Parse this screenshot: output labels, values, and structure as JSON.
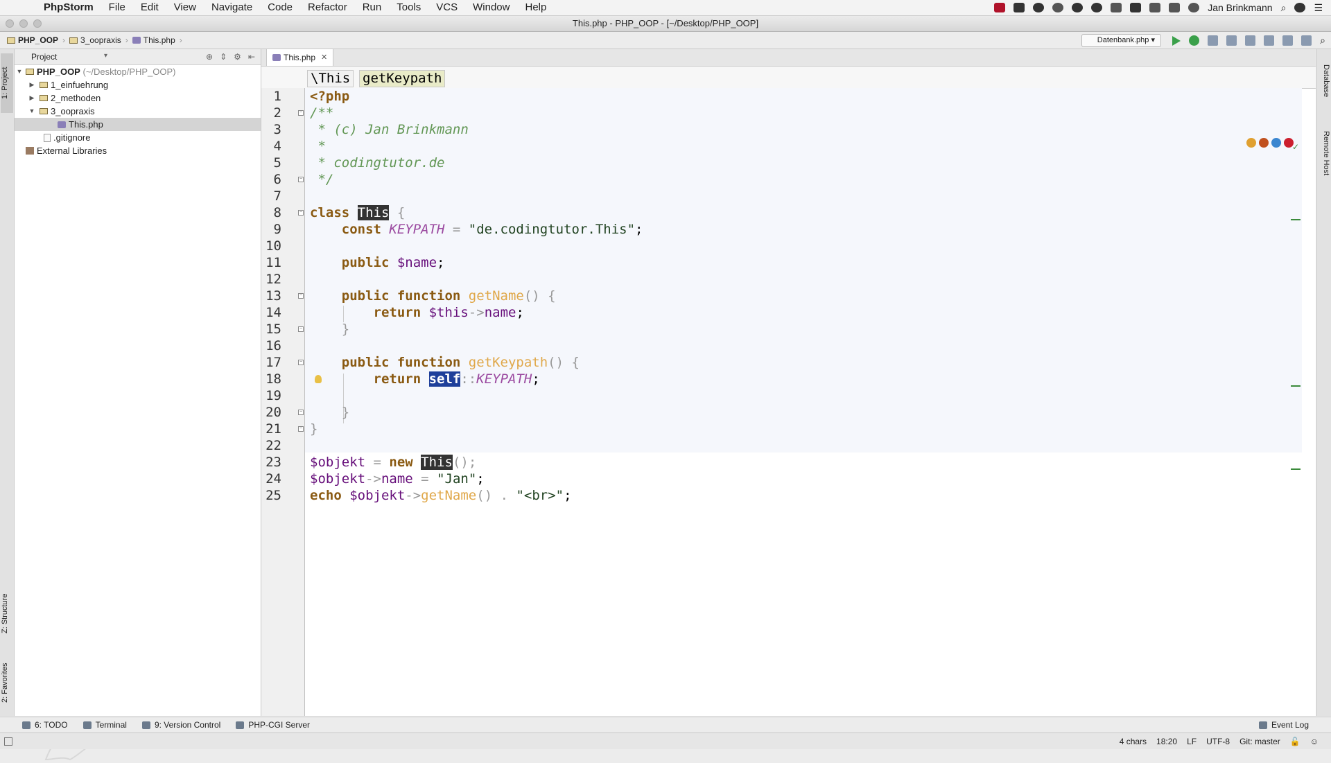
{
  "menubar": {
    "app_name": "PhpStorm",
    "items": [
      "File",
      "Edit",
      "View",
      "Navigate",
      "Code",
      "Refactor",
      "Run",
      "Tools",
      "VCS",
      "Window",
      "Help"
    ],
    "user": "Jan Brinkmann"
  },
  "window": {
    "title": "This.php - PHP_OOP - [~/Desktop/PHP_OOP]"
  },
  "navbar": {
    "crumbs": [
      "PHP_OOP",
      "3_oopraxis",
      "This.php"
    ],
    "run_config": "Datenbank.php"
  },
  "sidebar": {
    "tabs": {
      "project": "1: Project",
      "structure": "Z: Structure",
      "favorites": "2: Favorites"
    },
    "header": "Project",
    "tree": [
      {
        "label": "PHP_OOP",
        "suffix": "(~/Desktop/PHP_OOP)"
      },
      {
        "label": "1_einfuehrung"
      },
      {
        "label": "2_methoden"
      },
      {
        "label": "3_oopraxis"
      },
      {
        "label": "This.php"
      },
      {
        "label": ".gitignore"
      },
      {
        "label": "External Libraries"
      }
    ]
  },
  "editor": {
    "tab": "This.php",
    "breadcrumbs": [
      "\\This",
      "getKeypath"
    ],
    "line_numbers": [
      "1",
      "2",
      "3",
      "4",
      "5",
      "6",
      "7",
      "8",
      "9",
      "10",
      "11",
      "12",
      "13",
      "14",
      "15",
      "16",
      "17",
      "18",
      "19",
      "20",
      "21",
      "22",
      "23",
      "24",
      "25"
    ],
    "code": {
      "l1": "<?php",
      "l2": "/**",
      "l3": " * (c) Jan Brinkmann",
      "l4": " *",
      "l5": " * codingtutor.de",
      "l6": " */",
      "l8_kw": "class ",
      "l8_name": "This",
      "l8_brace": " {",
      "l9_kw": "    const ",
      "l9_const": "KEYPATH",
      "l9_eq": " = ",
      "l9_str": "\"de.codingtutor.This\"",
      "l9_end": ";",
      "l11_kw": "    public ",
      "l11_var": "$name",
      "l11_end": ";",
      "l13_kw": "    public function ",
      "l13_fn": "getName",
      "l13_rest": "() {",
      "l14_kw": "        return ",
      "l14_var": "$this",
      "l14_arrow": "->",
      "l14_prop": "name",
      "l14_end": ";",
      "l15": "    }",
      "l17_kw": "    public function ",
      "l17_fn": "getKeypath",
      "l17_rest": "() {",
      "l18_kw": "        return ",
      "l18_self": "self",
      "l18_sep": "::",
      "l18_const": "KEYPATH",
      "l18_end": ";",
      "l20": "    }",
      "l21": "}",
      "l23_var": "$objekt",
      "l23_eq": " = ",
      "l23_kw": "new ",
      "l23_cls": "This",
      "l23_end": "();",
      "l24_var": "$objekt",
      "l24_arrow": "->",
      "l24_prop": "name",
      "l24_eq": " = ",
      "l24_str": "\"Jan\"",
      "l24_end": ";",
      "l25_kw": "echo ",
      "l25_var": "$objekt",
      "l25_arrow": "->",
      "l25_fn": "getName",
      "l25_mid": "() . ",
      "l25_str": "\"<br>\"",
      "l25_end": ";"
    }
  },
  "right_strip": {
    "database": "Database",
    "remote_host": "Remote Host"
  },
  "bottom_tools": [
    "6: TODO",
    "Terminal",
    "9: Version Control",
    "PHP-CGI Server"
  ],
  "event_log": "Event Log",
  "status": {
    "chars": "4 chars",
    "position": "18:20",
    "line_sep": "LF",
    "encoding": "UTF-8",
    "vcs": "Git: master"
  },
  "colors": {
    "keyword": "#000080",
    "comment": "#629755",
    "function": "#e0a84a",
    "constant": "#9b4aa0",
    "variable": "#660e7a"
  }
}
